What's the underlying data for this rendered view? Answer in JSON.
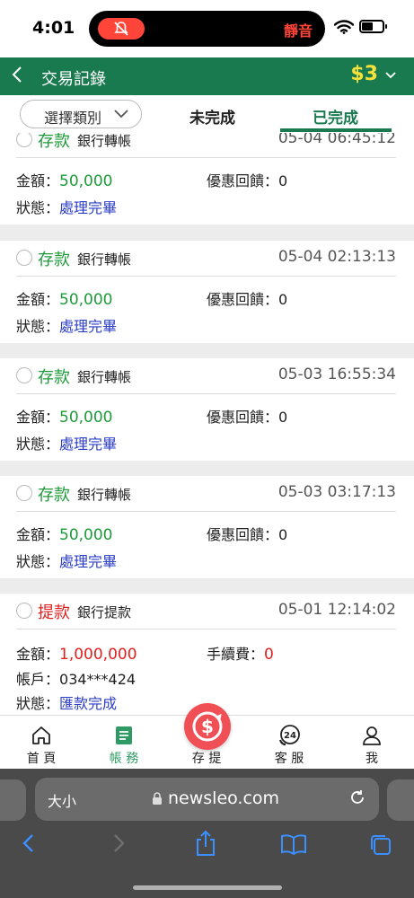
{
  "status": {
    "time": "4:01",
    "mute_label": "靜音"
  },
  "header": {
    "back_icon": "chevron-left-icon",
    "title": "交易記錄",
    "balance": "$3"
  },
  "tabs": {
    "category": "選擇類別",
    "pending": "未完成",
    "completed": "已完成"
  },
  "labels": {
    "amount": "金額：",
    "bonus": "優惠回饋：",
    "fee": "手續費：",
    "status": "狀態：",
    "account": "帳戶："
  },
  "records": [
    {
      "kind": "存款",
      "method": "銀行轉帳",
      "time": "05-04 06:45:12",
      "amount": "50,000",
      "bonus": "0",
      "status": "處理完畢"
    },
    {
      "kind": "存款",
      "method": "銀行轉帳",
      "time": "05-04 02:13:13",
      "amount": "50,000",
      "bonus": "0",
      "status": "處理完畢"
    },
    {
      "kind": "存款",
      "method": "銀行轉帳",
      "time": "05-03 16:55:34",
      "amount": "50,000",
      "bonus": "0",
      "status": "處理完畢"
    },
    {
      "kind": "存款",
      "method": "銀行轉帳",
      "time": "05-03 03:17:13",
      "amount": "50,000",
      "bonus": "0",
      "status": "處理完畢"
    },
    {
      "kind": "提款",
      "method": "銀行提款",
      "time": "05-01 12:14:02",
      "amount": "1,000,000",
      "fee": "0",
      "account": "034***424",
      "status": "匯款完成"
    }
  ],
  "bottom_nav": {
    "home": "首 頁",
    "account": "帳 務",
    "deposit": "存 提",
    "service": "客 服",
    "me": "我"
  },
  "browser": {
    "text_size": "大小",
    "url": "newsleo.com"
  },
  "colors": {
    "brand": "#1a7a4f",
    "deposit": "#1e9a3a",
    "withdraw": "#e0201f",
    "status_link": "#2b3ec7",
    "balance": "#f5e13a"
  }
}
